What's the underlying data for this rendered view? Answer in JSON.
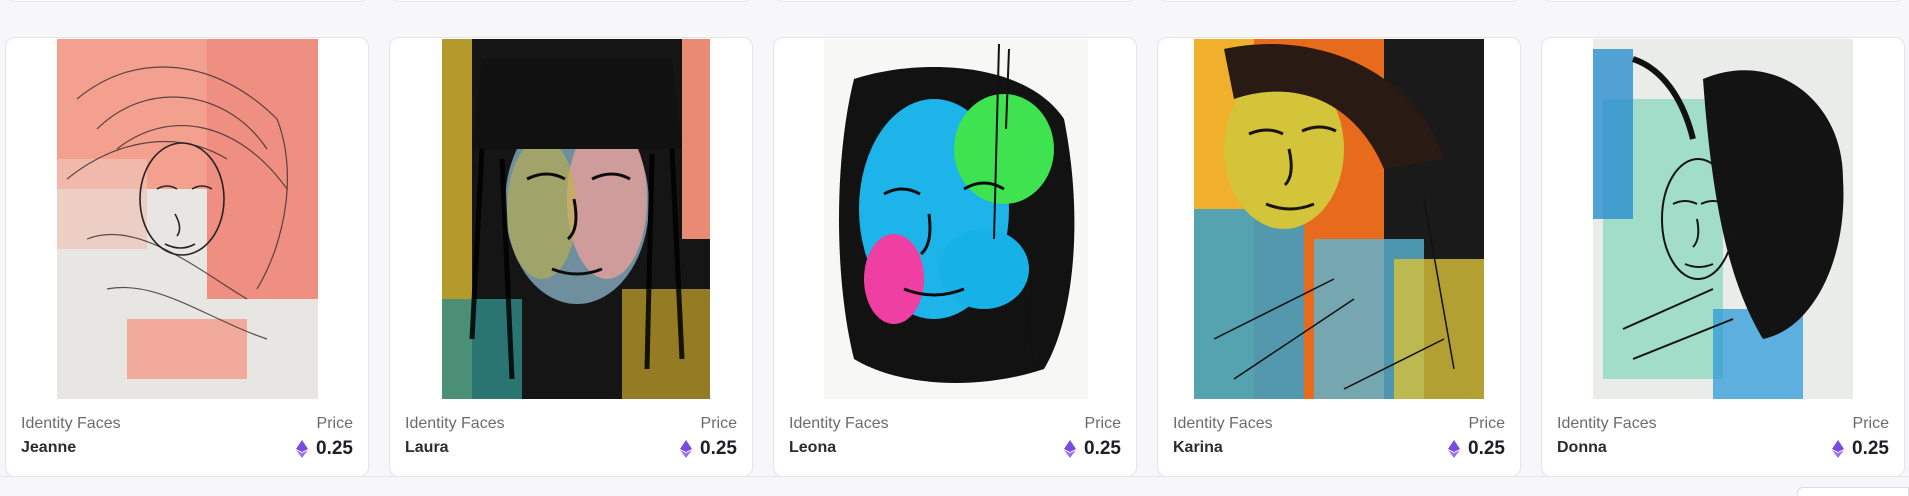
{
  "theme": {
    "eth_color": "#7b4ae2",
    "card_background": "#ffffff",
    "border_color": "#e4e4e8"
  },
  "cards": [
    {
      "collection": "Identity Faces",
      "name": "Jeanne",
      "price_label": "Price",
      "price": "0.25",
      "currency_icon": "ethereum-icon"
    },
    {
      "collection": "Identity Faces",
      "name": "Laura",
      "price_label": "Price",
      "price": "0.25",
      "currency_icon": "ethereum-icon"
    },
    {
      "collection": "Identity Faces",
      "name": "Leona",
      "price_label": "Price",
      "price": "0.25",
      "currency_icon": "ethereum-icon"
    },
    {
      "collection": "Identity Faces",
      "name": "Karina",
      "price_label": "Price",
      "price": "0.25",
      "currency_icon": "ethereum-icon"
    },
    {
      "collection": "Identity Faces",
      "name": "Donna",
      "price_label": "Price",
      "price": "0.25",
      "currency_icon": "ethereum-icon"
    }
  ]
}
